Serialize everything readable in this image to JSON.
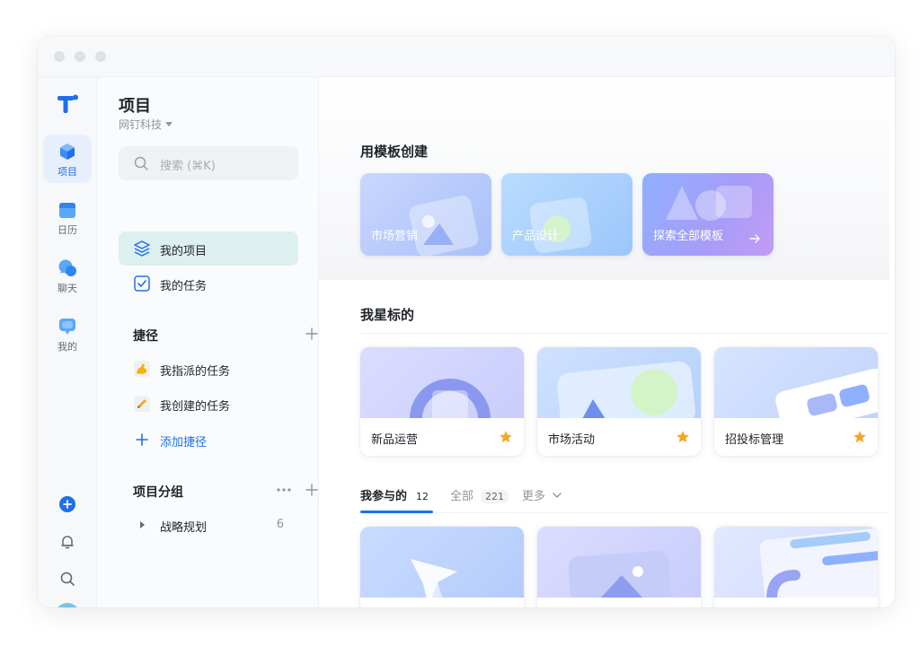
{
  "colors": {
    "accent": "#1f6feb",
    "active_nav_bg": "#dcf0ef",
    "star": "#f5a623"
  },
  "rail": {
    "items": [
      {
        "label": "项目",
        "icon": "project-cube-icon",
        "active": true
      },
      {
        "label": "日历",
        "icon": "calendar-icon",
        "active": false
      },
      {
        "label": "聊天",
        "icon": "chat-icon",
        "active": false
      },
      {
        "label": "我的",
        "icon": "profile-icon",
        "active": false
      }
    ],
    "bottom": [
      "plus-circle-icon",
      "bell-icon",
      "search-icon",
      "avatar"
    ]
  },
  "sidebar": {
    "title": "项目",
    "org": "网钉科技",
    "search_placeholder": "搜索 (⌘K)",
    "nav": [
      {
        "label": "我的项目",
        "icon": "layers-icon",
        "active": true
      },
      {
        "label": "我的任务",
        "icon": "checkbox-icon",
        "active": false
      }
    ],
    "shortcuts": {
      "title": "捷径",
      "items": [
        {
          "label": "我指派的任务",
          "icon": "flexed-arm-emoji-icon"
        },
        {
          "label": "我创建的任务",
          "icon": "pencil-emoji-icon"
        }
      ],
      "add_label": "添加捷径"
    },
    "groups": {
      "title": "项目分组",
      "items": [
        {
          "label": "战略规划",
          "count": "6"
        }
      ]
    }
  },
  "main": {
    "templates": {
      "title": "用模板创建",
      "cards": [
        {
          "label": "市场营销"
        },
        {
          "label": "产品设计"
        },
        {
          "label": "探索全部模板"
        }
      ]
    },
    "starred": {
      "title": "我星标的",
      "cards": [
        {
          "name": "新品运营"
        },
        {
          "name": "市场活动"
        },
        {
          "name": "招投标管理"
        }
      ]
    },
    "tabs": [
      {
        "label": "我参与的",
        "count": "12",
        "active": true
      },
      {
        "label": "全部",
        "count": "221",
        "active": false
      },
      {
        "label": "更多",
        "active": false
      }
    ]
  }
}
